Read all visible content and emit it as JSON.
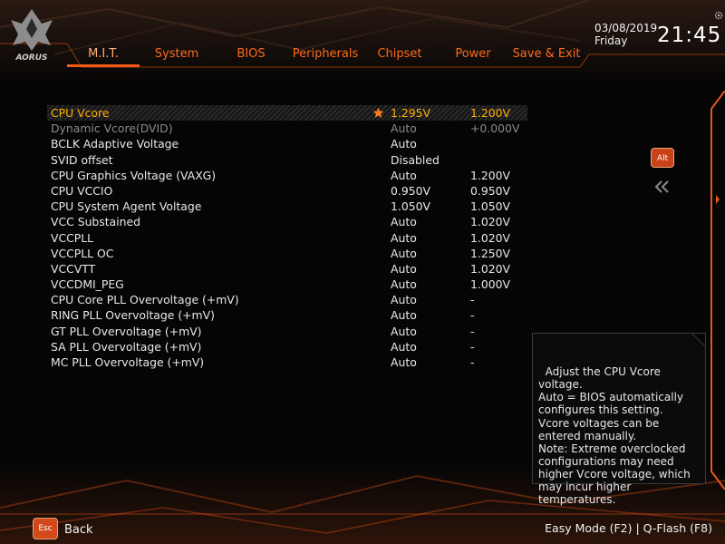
{
  "header": {
    "date": "03/08/2019",
    "day": "Friday",
    "time": "21:45",
    "logo_text": "AORUS"
  },
  "tabs": [
    {
      "label": "M.I.T.",
      "active": true
    },
    {
      "label": "System"
    },
    {
      "label": "BIOS"
    },
    {
      "label": "Peripherals"
    },
    {
      "label": "Chipset"
    },
    {
      "label": "Power"
    },
    {
      "label": "Save & Exit"
    }
  ],
  "settings": [
    {
      "label": "CPU Vcore",
      "current": "1.295V",
      "value": "1.200V",
      "selected": true
    },
    {
      "label": "Dynamic Vcore(DVID)",
      "current": "Auto",
      "value": "+0.000V",
      "dimmed": true
    },
    {
      "label": "BCLK Adaptive Voltage",
      "current": "Auto",
      "value": ""
    },
    {
      "label": "SVID offset",
      "current": "Disabled",
      "value": ""
    },
    {
      "label": "CPU Graphics Voltage (VAXG)",
      "current": "Auto",
      "value": "1.200V"
    },
    {
      "label": "CPU VCCIO",
      "current": "0.950V",
      "value": "0.950V"
    },
    {
      "label": "CPU System Agent Voltage",
      "current": "1.050V",
      "value": "1.050V"
    },
    {
      "label": "VCC Substained",
      "current": "Auto",
      "value": "1.020V"
    },
    {
      "label": "VCCPLL",
      "current": "Auto",
      "value": "1.020V"
    },
    {
      "label": "VCCPLL OC",
      "current": "Auto",
      "value": "1.250V"
    },
    {
      "label": "VCCVTT",
      "current": "Auto",
      "value": "1.020V"
    },
    {
      "label": "VCCDMI_PEG",
      "current": "Auto",
      "value": "1.000V"
    },
    {
      "label": "CPU Core PLL Overvoltage (+mV)",
      "current": "Auto",
      "value": "-"
    },
    {
      "label": "RING PLL Overvoltage (+mV)",
      "current": "Auto",
      "value": "-"
    },
    {
      "label": "GT PLL Overvoltage (+mV)",
      "current": "Auto",
      "value": "-"
    },
    {
      "label": "SA PLL Overvoltage (+mV)",
      "current": "Auto",
      "value": "-"
    },
    {
      "label": "MC PLL Overvoltage (+mV)",
      "current": "Auto",
      "value": "-"
    }
  ],
  "side": {
    "alt_key": "Alt",
    "collapse_icon": "double-chevron-left-icon"
  },
  "help": {
    "text": "Adjust the CPU Vcore\nvoltage.\nAuto = BIOS automatically\nconfigures this setting.\nVcore voltages can be\nentered manually.\nNote: Extreme overclocked\nconfigurations may need\nhigher Vcore voltage, which\nmay incur higher\ntemperatures."
  },
  "footer": {
    "esc_key": "Esc",
    "back_label": "Back",
    "right_text": "Easy Mode (F2)  |  Q-Flash (F8)"
  },
  "colors": {
    "accent": "#ff6a1a",
    "selected_text": "#ffb000",
    "dimmed_text": "#8a8a8a",
    "background": "#050505"
  }
}
